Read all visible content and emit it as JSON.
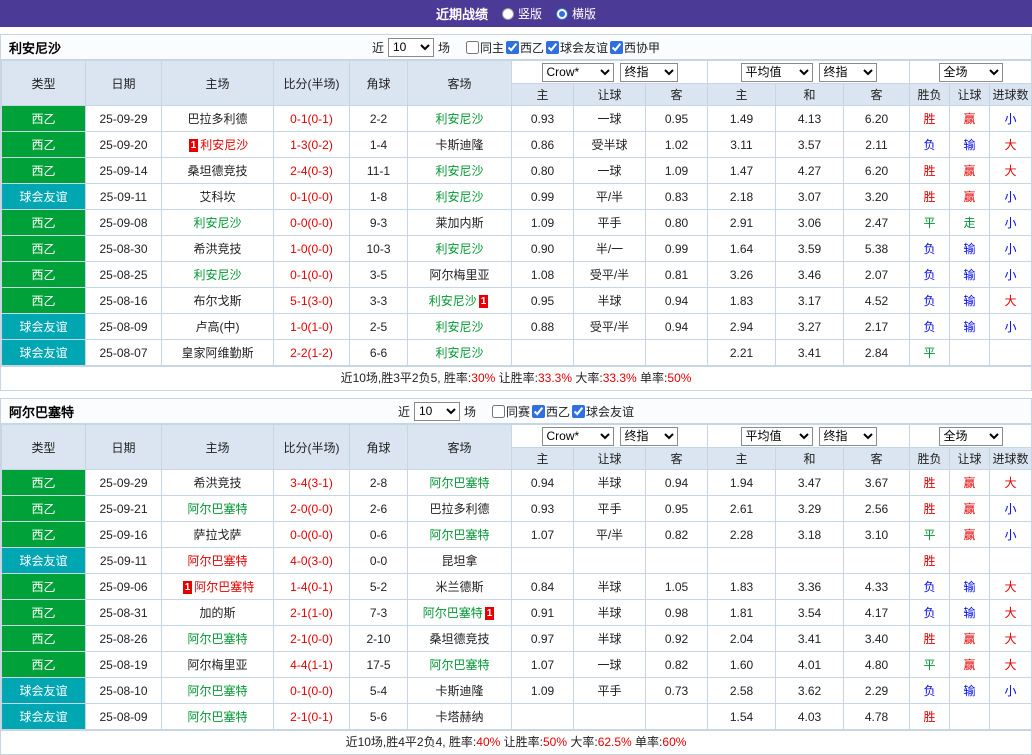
{
  "topbar": {
    "title": "近期战绩",
    "layout_options": [
      {
        "label": "竖版",
        "selected": false
      },
      {
        "label": "横版",
        "selected": true
      }
    ]
  },
  "colors": {
    "accent_purple": "#4c3a97",
    "league_badge_green": "#00a138",
    "friendly_badge_teal": "#00a7b3",
    "win_red": "#e60000",
    "lose_blue": "#0008e6",
    "draw_green": "#009933",
    "header_blue": "#dbe5f1"
  },
  "header": {
    "main_cols": [
      "类型",
      "日期",
      "主场",
      "比分(半场)",
      "角球",
      "客场"
    ],
    "odds_cols": [
      "主",
      "让球",
      "客"
    ],
    "avg_cols": [
      "主",
      "和",
      "客"
    ],
    "result_cols": [
      "胜负",
      "让球",
      "进球数"
    ],
    "dropdowns": {
      "odds_company": "Crow*",
      "odds_type": "终指",
      "avg_label": "平均值",
      "avg_type": "终指",
      "scope": "全场"
    }
  },
  "sections": [
    {
      "team": "利安尼沙",
      "filter": {
        "prefix": "近",
        "count": "10",
        "suffix": "场",
        "checkboxes": [
          {
            "label": "同主",
            "checked": false
          },
          {
            "label": "西乙",
            "checked": true
          },
          {
            "label": "球会友谊",
            "checked": true
          },
          {
            "label": "西协甲",
            "checked": true
          }
        ]
      },
      "rows": [
        {
          "type": "西乙",
          "type_style": "green",
          "date": "25-09-29",
          "home": {
            "name": "巴拉多利德",
            "color": "black"
          },
          "score": "0-1(0-1)",
          "corner": "2-2",
          "away": {
            "name": "利安尼沙",
            "color": "green"
          },
          "odds": [
            "0.93",
            "一球",
            "0.95"
          ],
          "avg": [
            "1.49",
            "4.13",
            "6.20"
          ],
          "outcome": {
            "text": "胜",
            "color": "red"
          },
          "handicap": {
            "text": "赢",
            "color": "red"
          },
          "goals": {
            "text": "小",
            "color": "blue"
          }
        },
        {
          "type": "西乙",
          "type_style": "green",
          "date": "25-09-20",
          "home": {
            "name": "利安尼沙",
            "color": "red",
            "badge": "1",
            "badge_pos": "before"
          },
          "score": "1-3(0-2)",
          "corner": "1-4",
          "away": {
            "name": "卡斯迪隆",
            "color": "black"
          },
          "odds": [
            "0.86",
            "受半球",
            "1.02"
          ],
          "avg": [
            "3.11",
            "3.57",
            "2.11"
          ],
          "outcome": {
            "text": "负",
            "color": "blue"
          },
          "handicap": {
            "text": "输",
            "color": "blue"
          },
          "goals": {
            "text": "大",
            "color": "red"
          }
        },
        {
          "type": "西乙",
          "type_style": "green",
          "date": "25-09-14",
          "home": {
            "name": "桑坦德竞技",
            "color": "black"
          },
          "score": "2-4(0-3)",
          "corner": "11-1",
          "away": {
            "name": "利安尼沙",
            "color": "green"
          },
          "odds": [
            "0.80",
            "一球",
            "1.09"
          ],
          "avg": [
            "1.47",
            "4.27",
            "6.20"
          ],
          "outcome": {
            "text": "胜",
            "color": "red"
          },
          "handicap": {
            "text": "赢",
            "color": "red"
          },
          "goals": {
            "text": "大",
            "color": "red"
          }
        },
        {
          "type": "球会友谊",
          "type_style": "teal",
          "date": "25-09-11",
          "home": {
            "name": "艾科坎",
            "color": "black"
          },
          "score": "0-1(0-0)",
          "corner": "1-8",
          "away": {
            "name": "利安尼沙",
            "color": "green"
          },
          "odds": [
            "0.99",
            "平/半",
            "0.83"
          ],
          "avg": [
            "2.18",
            "3.07",
            "3.20"
          ],
          "outcome": {
            "text": "胜",
            "color": "red"
          },
          "handicap": {
            "text": "赢",
            "color": "red"
          },
          "goals": {
            "text": "小",
            "color": "blue"
          }
        },
        {
          "type": "西乙",
          "type_style": "green",
          "date": "25-09-08",
          "home": {
            "name": "利安尼沙",
            "color": "green"
          },
          "score": "0-0(0-0)",
          "corner": "9-3",
          "away": {
            "name": "莱加内斯",
            "color": "black"
          },
          "odds": [
            "1.09",
            "平手",
            "0.80"
          ],
          "avg": [
            "2.91",
            "3.06",
            "2.47"
          ],
          "outcome": {
            "text": "平",
            "color": "green"
          },
          "handicap": {
            "text": "走",
            "color": "green"
          },
          "goals": {
            "text": "小",
            "color": "blue"
          }
        },
        {
          "type": "西乙",
          "type_style": "green",
          "date": "25-08-30",
          "home": {
            "name": "希洪竞技",
            "color": "black"
          },
          "score": "1-0(0-0)",
          "corner": "10-3",
          "away": {
            "name": "利安尼沙",
            "color": "green"
          },
          "odds": [
            "0.90",
            "半/一",
            "0.99"
          ],
          "avg": [
            "1.64",
            "3.59",
            "5.38"
          ],
          "outcome": {
            "text": "负",
            "color": "blue"
          },
          "handicap": {
            "text": "输",
            "color": "blue"
          },
          "goals": {
            "text": "小",
            "color": "blue"
          }
        },
        {
          "type": "西乙",
          "type_style": "green",
          "date": "25-08-25",
          "home": {
            "name": "利安尼沙",
            "color": "green"
          },
          "score": "0-1(0-0)",
          "corner": "3-5",
          "away": {
            "name": "阿尔梅里亚",
            "color": "black"
          },
          "odds": [
            "1.08",
            "受平/半",
            "0.81"
          ],
          "avg": [
            "3.26",
            "3.46",
            "2.07"
          ],
          "outcome": {
            "text": "负",
            "color": "blue"
          },
          "handicap": {
            "text": "输",
            "color": "blue"
          },
          "goals": {
            "text": "小",
            "color": "blue"
          }
        },
        {
          "type": "西乙",
          "type_style": "green",
          "date": "25-08-16",
          "home": {
            "name": "布尔戈斯",
            "color": "black"
          },
          "score": "5-1(3-0)",
          "corner": "3-3",
          "away": {
            "name": "利安尼沙",
            "color": "green",
            "badge": "1",
            "badge_pos": "after"
          },
          "odds": [
            "0.95",
            "半球",
            "0.94"
          ],
          "avg": [
            "1.83",
            "3.17",
            "4.52"
          ],
          "outcome": {
            "text": "负",
            "color": "blue"
          },
          "handicap": {
            "text": "输",
            "color": "blue"
          },
          "goals": {
            "text": "大",
            "color": "red"
          }
        },
        {
          "type": "球会友谊",
          "type_style": "teal",
          "date": "25-08-09",
          "home": {
            "name": "卢高(中)",
            "color": "black"
          },
          "score": "1-0(1-0)",
          "corner": "2-5",
          "away": {
            "name": "利安尼沙",
            "color": "green"
          },
          "odds": [
            "0.88",
            "受平/半",
            "0.94"
          ],
          "avg": [
            "2.94",
            "3.27",
            "2.17"
          ],
          "outcome": {
            "text": "负",
            "color": "blue"
          },
          "handicap": {
            "text": "输",
            "color": "blue"
          },
          "goals": {
            "text": "小",
            "color": "blue"
          }
        },
        {
          "type": "球会友谊",
          "type_style": "teal",
          "date": "25-08-07",
          "home": {
            "name": "皇家阿维勤斯",
            "color": "black"
          },
          "score": "2-2(1-2)",
          "corner": "6-6",
          "away": {
            "name": "利安尼沙",
            "color": "green"
          },
          "odds": [
            "",
            "",
            ""
          ],
          "avg": [
            "2.21",
            "3.41",
            "2.84"
          ],
          "outcome": {
            "text": "平",
            "color": "green"
          },
          "handicap": {
            "text": "",
            "color": "black"
          },
          "goals": {
            "text": "",
            "color": "black"
          }
        }
      ],
      "summary": [
        {
          "text": "近10场,胜3平2负5, 胜率:",
          "color": "black"
        },
        {
          "text": "30%",
          "color": "red"
        },
        {
          "text": " 让胜率:",
          "color": "black"
        },
        {
          "text": "33.3%",
          "color": "red"
        },
        {
          "text": " 大率:",
          "color": "black"
        },
        {
          "text": "33.3%",
          "color": "red"
        },
        {
          "text": " 单率:",
          "color": "black"
        },
        {
          "text": "50%",
          "color": "red"
        }
      ]
    },
    {
      "team": "阿尔巴塞特",
      "filter": {
        "prefix": "近",
        "count": "10",
        "suffix": "场",
        "checkboxes": [
          {
            "label": "同赛",
            "checked": false
          },
          {
            "label": "西乙",
            "checked": true
          },
          {
            "label": "球会友谊",
            "checked": true
          }
        ]
      },
      "rows": [
        {
          "type": "西乙",
          "type_style": "green",
          "date": "25-09-29",
          "home": {
            "name": "希洪竞技",
            "color": "black"
          },
          "score": "3-4(3-1)",
          "corner": "2-8",
          "away": {
            "name": "阿尔巴塞特",
            "color": "green"
          },
          "odds": [
            "0.94",
            "半球",
            "0.94"
          ],
          "avg": [
            "1.94",
            "3.47",
            "3.67"
          ],
          "outcome": {
            "text": "胜",
            "color": "red"
          },
          "handicap": {
            "text": "赢",
            "color": "red"
          },
          "goals": {
            "text": "大",
            "color": "red"
          }
        },
        {
          "type": "西乙",
          "type_style": "green",
          "date": "25-09-21",
          "home": {
            "name": "阿尔巴塞特",
            "color": "green"
          },
          "score": "2-0(0-0)",
          "corner": "2-6",
          "away": {
            "name": "巴拉多利德",
            "color": "black"
          },
          "odds": [
            "0.93",
            "平手",
            "0.95"
          ],
          "avg": [
            "2.61",
            "3.29",
            "2.56"
          ],
          "outcome": {
            "text": "胜",
            "color": "red"
          },
          "handicap": {
            "text": "赢",
            "color": "red"
          },
          "goals": {
            "text": "小",
            "color": "blue"
          }
        },
        {
          "type": "西乙",
          "type_style": "green",
          "date": "25-09-16",
          "home": {
            "name": "萨拉戈萨",
            "color": "black"
          },
          "score": "0-0(0-0)",
          "corner": "0-6",
          "away": {
            "name": "阿尔巴塞特",
            "color": "green"
          },
          "odds": [
            "1.07",
            "平/半",
            "0.82"
          ],
          "avg": [
            "2.28",
            "3.18",
            "3.10"
          ],
          "outcome": {
            "text": "平",
            "color": "green"
          },
          "handicap": {
            "text": "赢",
            "color": "red"
          },
          "goals": {
            "text": "小",
            "color": "blue"
          }
        },
        {
          "type": "球会友谊",
          "type_style": "teal",
          "date": "25-09-11",
          "home": {
            "name": "阿尔巴塞特",
            "color": "red"
          },
          "score": "4-0(3-0)",
          "corner": "0-0",
          "away": {
            "name": "昆坦拿",
            "color": "black"
          },
          "odds": [
            "",
            "",
            ""
          ],
          "avg": [
            "",
            "",
            ""
          ],
          "outcome": {
            "text": "胜",
            "color": "red"
          },
          "handicap": {
            "text": "",
            "color": "black"
          },
          "goals": {
            "text": "",
            "color": "black"
          }
        },
        {
          "type": "西乙",
          "type_style": "green",
          "date": "25-09-06",
          "home": {
            "name": "阿尔巴塞特",
            "color": "red",
            "badge": "1",
            "badge_pos": "before"
          },
          "score": "1-4(0-1)",
          "corner": "5-2",
          "away": {
            "name": "米兰德斯",
            "color": "black"
          },
          "odds": [
            "0.84",
            "半球",
            "1.05"
          ],
          "avg": [
            "1.83",
            "3.36",
            "4.33"
          ],
          "outcome": {
            "text": "负",
            "color": "blue"
          },
          "handicap": {
            "text": "输",
            "color": "blue"
          },
          "goals": {
            "text": "大",
            "color": "red"
          }
        },
        {
          "type": "西乙",
          "type_style": "green",
          "date": "25-08-31",
          "home": {
            "name": "加的斯",
            "color": "black"
          },
          "score": "2-1(1-0)",
          "corner": "7-3",
          "away": {
            "name": "阿尔巴塞特",
            "color": "green",
            "badge": "1",
            "badge_pos": "after"
          },
          "odds": [
            "0.91",
            "半球",
            "0.98"
          ],
          "avg": [
            "1.81",
            "3.54",
            "4.17"
          ],
          "outcome": {
            "text": "负",
            "color": "blue"
          },
          "handicap": {
            "text": "输",
            "color": "blue"
          },
          "goals": {
            "text": "大",
            "color": "red"
          }
        },
        {
          "type": "西乙",
          "type_style": "green",
          "date": "25-08-26",
          "home": {
            "name": "阿尔巴塞特",
            "color": "green"
          },
          "score": "2-1(0-0)",
          "corner": "2-10",
          "away": {
            "name": "桑坦德竞技",
            "color": "black"
          },
          "odds": [
            "0.97",
            "半球",
            "0.92"
          ],
          "avg": [
            "2.04",
            "3.41",
            "3.40"
          ],
          "outcome": {
            "text": "胜",
            "color": "red"
          },
          "handicap": {
            "text": "赢",
            "color": "red"
          },
          "goals": {
            "text": "大",
            "color": "red"
          }
        },
        {
          "type": "西乙",
          "type_style": "green",
          "date": "25-08-19",
          "home": {
            "name": "阿尔梅里亚",
            "color": "black"
          },
          "score": "4-4(1-1)",
          "corner": "17-5",
          "away": {
            "name": "阿尔巴塞特",
            "color": "green"
          },
          "odds": [
            "1.07",
            "一球",
            "0.82"
          ],
          "avg": [
            "1.60",
            "4.01",
            "4.80"
          ],
          "outcome": {
            "text": "平",
            "color": "green"
          },
          "handicap": {
            "text": "赢",
            "color": "red"
          },
          "goals": {
            "text": "大",
            "color": "red"
          }
        },
        {
          "type": "球会友谊",
          "type_style": "teal",
          "date": "25-08-10",
          "home": {
            "name": "阿尔巴塞特",
            "color": "green"
          },
          "score": "0-1(0-0)",
          "corner": "5-4",
          "away": {
            "name": "卡斯迪隆",
            "color": "black"
          },
          "odds": [
            "1.09",
            "平手",
            "0.73"
          ],
          "avg": [
            "2.58",
            "3.62",
            "2.29"
          ],
          "outcome": {
            "text": "负",
            "color": "blue"
          },
          "handicap": {
            "text": "输",
            "color": "blue"
          },
          "goals": {
            "text": "小",
            "color": "blue"
          }
        },
        {
          "type": "球会友谊",
          "type_style": "teal",
          "date": "25-08-09",
          "home": {
            "name": "阿尔巴塞特",
            "color": "green"
          },
          "score": "2-1(0-1)",
          "corner": "5-6",
          "away": {
            "name": "卡塔赫纳",
            "color": "black"
          },
          "odds": [
            "",
            "",
            ""
          ],
          "avg": [
            "1.54",
            "4.03",
            "4.78"
          ],
          "outcome": {
            "text": "胜",
            "color": "red"
          },
          "handicap": {
            "text": "",
            "color": "black"
          },
          "goals": {
            "text": "",
            "color": "black"
          }
        }
      ],
      "summary": [
        {
          "text": "近10场,胜4平2负4, 胜率:",
          "color": "black"
        },
        {
          "text": "40%",
          "color": "red"
        },
        {
          "text": " 让胜率:",
          "color": "black"
        },
        {
          "text": "50%",
          "color": "red"
        },
        {
          "text": " 大率:",
          "color": "black"
        },
        {
          "text": "62.5%",
          "color": "red"
        },
        {
          "text": " 单率:",
          "color": "black"
        },
        {
          "text": "60%",
          "color": "red"
        }
      ]
    }
  ]
}
